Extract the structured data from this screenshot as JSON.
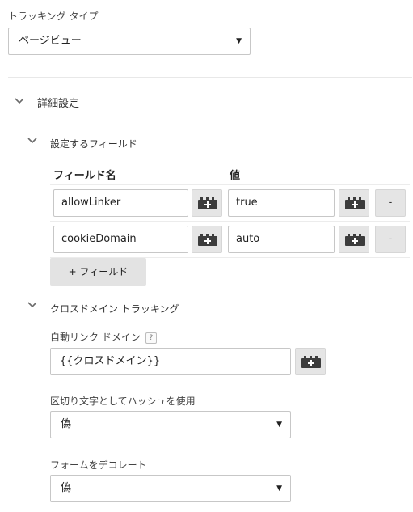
{
  "tracking_type": {
    "label": "トラッキング タイプ",
    "value": "ページビュー"
  },
  "advanced": {
    "title": "詳細設定"
  },
  "fields_to_set": {
    "title": "設定するフィールド",
    "col_field_name": "フィールド名",
    "col_value": "値",
    "rows": [
      {
        "field": "allowLinker",
        "value": "true",
        "remove_label": "-"
      },
      {
        "field": "cookieDomain",
        "value": "auto",
        "remove_label": "-"
      }
    ],
    "add_label": "+ フィールド"
  },
  "cross_domain": {
    "title": "クロスドメイン トラッキング",
    "auto_link_label": "自動リンク ドメイン",
    "help_glyph": "?",
    "auto_link_value": "{{クロスドメイン}}",
    "hash_label": "区切り文字としてハッシュを使用",
    "hash_value": "偽",
    "decorate_label": "フォームをデコレート",
    "decorate_value": "偽"
  },
  "icons": {
    "caret": "caret-down-icon",
    "chevron": "chevron-down-icon",
    "variable": "variable-picker-icon"
  }
}
